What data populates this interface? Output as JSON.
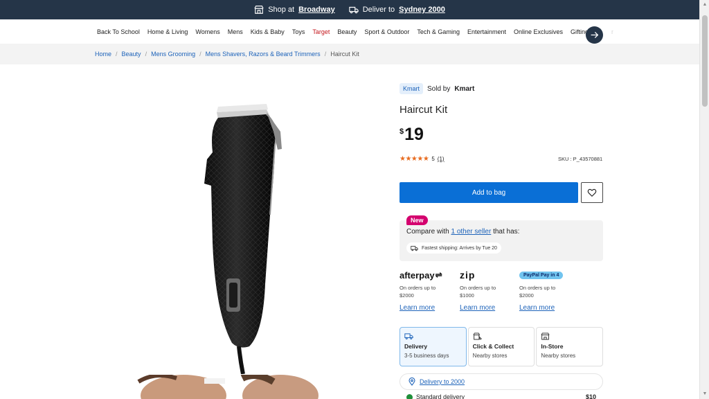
{
  "topbar": {
    "shop_prefix": "Shop at",
    "shop_store": "Broadway",
    "deliver_prefix": "Deliver to",
    "deliver_location": "Sydney 2000"
  },
  "nav": {
    "items": [
      "Back To School",
      "Home & Living",
      "Womens",
      "Mens",
      "Kids & Baby",
      "Toys",
      "Target",
      "Beauty",
      "Sport & Outdoor",
      "Tech & Gaming",
      "Entertainment",
      "Online Exclusives",
      "Gifting",
      "r"
    ]
  },
  "breadcrumb": [
    "Home",
    "Beauty",
    "Mens Grooming",
    "Mens Shavers, Razors & Beard Trimmers",
    "Haircut Kit"
  ],
  "product": {
    "brand_badge": "Kmart",
    "sold_by_prefix": "Sold by",
    "sold_by": "Kmart",
    "title": "Haircut Kit",
    "currency": "$",
    "price": "19",
    "stars": "★★★★★",
    "rating": "5",
    "review_count": "(1)",
    "sku": "SKU : P_43570881",
    "add_to_bag": "Add to bag"
  },
  "compare": {
    "new_tag": "New",
    "prefix": "Compare with",
    "link": "1 other seller",
    "suffix": "that has:",
    "shipping_chip": "Fastest shipping: Arrives by Tue 20"
  },
  "payments": [
    {
      "logo": "afterpay",
      "line1": "On orders up to",
      "line2": "$2000",
      "learn": "Learn more"
    },
    {
      "logo": "zip",
      "line1": "On orders up to",
      "line2": "$1000",
      "learn": "Learn more"
    },
    {
      "logo": "PayPal Pay in 4",
      "line1": "On orders up to",
      "line2": "$2000",
      "learn": "Learn more"
    }
  ],
  "fulfilment": [
    {
      "title": "Delivery",
      "sub": "3-5 business days"
    },
    {
      "title": "Click & Collect",
      "sub": "Nearby stores"
    },
    {
      "title": "In-Store",
      "sub": "Nearby stores"
    }
  ],
  "delivery_to": "Delivery to 2000",
  "standard_delivery": {
    "label": "Standard delivery",
    "price": "$10"
  },
  "colors": {
    "topbar": "#253548",
    "primary": "#0a6fd6",
    "link": "#1c62b9",
    "new_tag": "#d4006e",
    "star": "#e86b1f"
  }
}
